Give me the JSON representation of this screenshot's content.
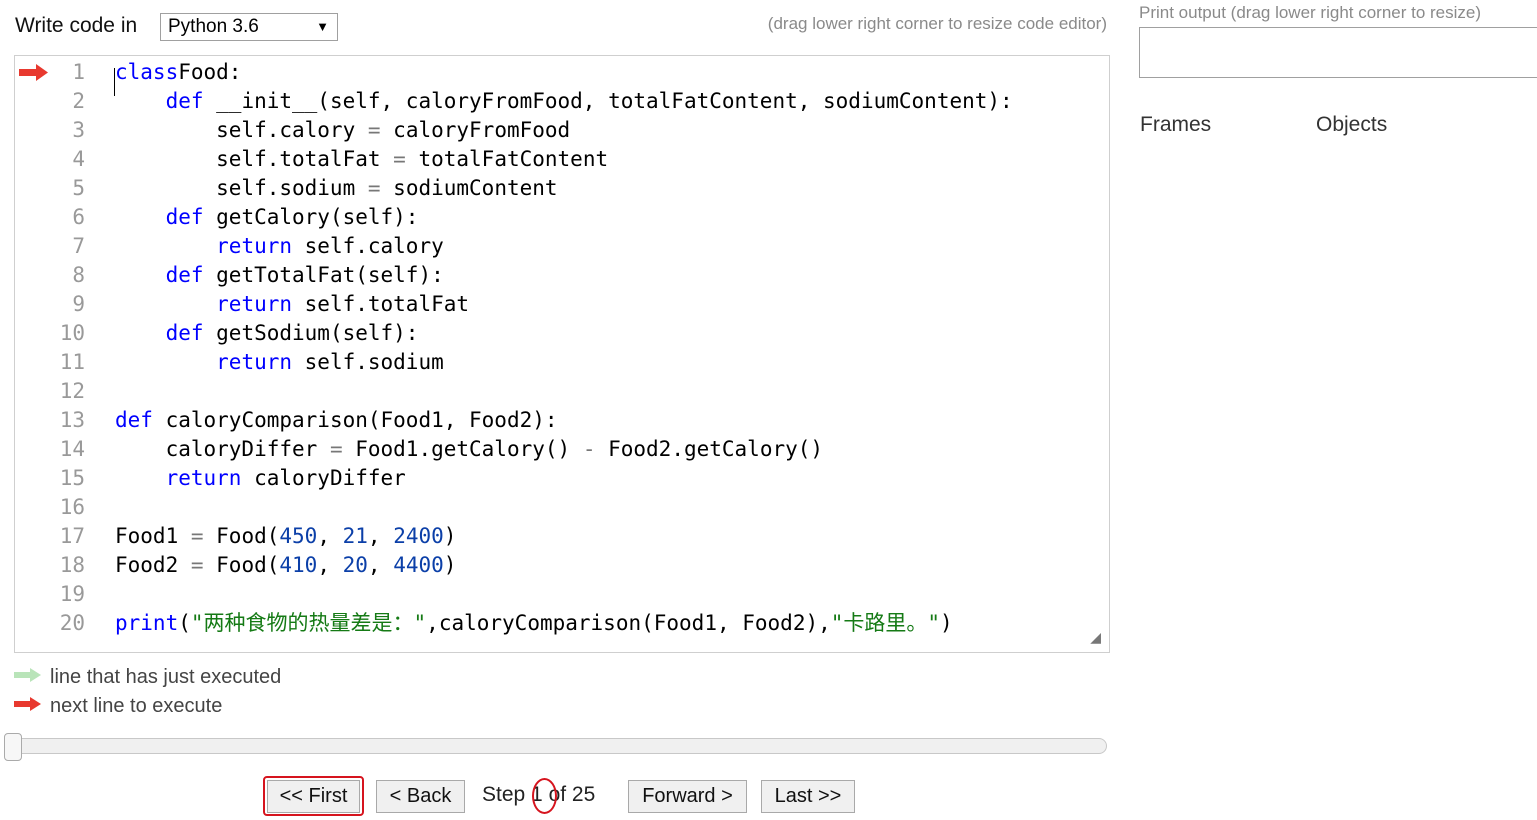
{
  "header": {
    "write_label": "Write code in",
    "language": "Python 3.6",
    "drag_hint": "(drag lower right corner to resize code editor)"
  },
  "editor": {
    "current_line": 1,
    "lines": [
      {
        "n": "1",
        "tokens": [
          [
            "kw",
            "class"
          ],
          [
            "",
            "Food:"
          ]
        ]
      },
      {
        "n": "2",
        "tokens": [
          [
            "",
            "    "
          ],
          [
            "kw",
            "def"
          ],
          [
            "",
            " __init__(self, caloryFromFood, totalFatContent, sodiumContent):"
          ]
        ]
      },
      {
        "n": "3",
        "tokens": [
          [
            "",
            "        self.calory "
          ],
          [
            "op",
            "="
          ],
          [
            "",
            " caloryFromFood"
          ]
        ]
      },
      {
        "n": "4",
        "tokens": [
          [
            "",
            "        self.totalFat "
          ],
          [
            "op",
            "="
          ],
          [
            "",
            " totalFatContent"
          ]
        ]
      },
      {
        "n": "5",
        "tokens": [
          [
            "",
            "        self.sodium "
          ],
          [
            "op",
            "="
          ],
          [
            "",
            " sodiumContent"
          ]
        ]
      },
      {
        "n": "6",
        "tokens": [
          [
            "",
            "    "
          ],
          [
            "kw",
            "def"
          ],
          [
            "",
            " getCalory(self):"
          ]
        ]
      },
      {
        "n": "7",
        "tokens": [
          [
            "",
            "        "
          ],
          [
            "kw",
            "return"
          ],
          [
            "",
            " self.calory"
          ]
        ]
      },
      {
        "n": "8",
        "tokens": [
          [
            "",
            "    "
          ],
          [
            "kw",
            "def"
          ],
          [
            "",
            " getTotalFat(self):"
          ]
        ]
      },
      {
        "n": "9",
        "tokens": [
          [
            "",
            "        "
          ],
          [
            "kw",
            "return"
          ],
          [
            "",
            " self.totalFat"
          ]
        ]
      },
      {
        "n": "10",
        "tokens": [
          [
            "",
            "    "
          ],
          [
            "kw",
            "def"
          ],
          [
            "",
            " getSodium(self):"
          ]
        ]
      },
      {
        "n": "11",
        "tokens": [
          [
            "",
            "        "
          ],
          [
            "kw",
            "return"
          ],
          [
            "",
            " self.sodium"
          ]
        ]
      },
      {
        "n": "12",
        "tokens": []
      },
      {
        "n": "13",
        "tokens": [
          [
            "kw",
            "def"
          ],
          [
            "",
            " caloryComparison(Food1, Food2):"
          ]
        ]
      },
      {
        "n": "14",
        "tokens": [
          [
            "",
            "    caloryDiffer "
          ],
          [
            "op",
            "="
          ],
          [
            "",
            " Food1.getCalory() "
          ],
          [
            "op",
            "-"
          ],
          [
            "",
            " Food2.getCalory()"
          ]
        ]
      },
      {
        "n": "15",
        "tokens": [
          [
            "",
            "    "
          ],
          [
            "kw",
            "return"
          ],
          [
            "",
            " caloryDiffer"
          ]
        ]
      },
      {
        "n": "16",
        "tokens": []
      },
      {
        "n": "17",
        "tokens": [
          [
            "",
            "Food1 "
          ],
          [
            "op",
            "="
          ],
          [
            "",
            " Food("
          ],
          [
            "num",
            "450"
          ],
          [
            "",
            ", "
          ],
          [
            "num",
            "21"
          ],
          [
            "",
            ", "
          ],
          [
            "num",
            "2400"
          ],
          [
            "",
            ")"
          ]
        ]
      },
      {
        "n": "18",
        "tokens": [
          [
            "",
            "Food2 "
          ],
          [
            "op",
            "="
          ],
          [
            "",
            " Food("
          ],
          [
            "num",
            "410"
          ],
          [
            "",
            ", "
          ],
          [
            "num",
            "20"
          ],
          [
            "",
            ", "
          ],
          [
            "num",
            "4400"
          ],
          [
            "",
            ")"
          ]
        ]
      },
      {
        "n": "19",
        "tokens": []
      },
      {
        "n": "20",
        "tokens": [
          [
            "kw",
            "print"
          ],
          [
            "",
            "("
          ],
          [
            "str",
            "\"两种食物的热量差是：\""
          ],
          [
            "",
            ",caloryComparison(Food1, Food2),"
          ],
          [
            "str",
            "\"卡路里。\""
          ],
          [
            "",
            ")"
          ]
        ]
      }
    ]
  },
  "legend": {
    "executed": "line that has just executed",
    "next": "next line to execute"
  },
  "navigation": {
    "first": "<< First",
    "back": "< Back",
    "step_word": "Step",
    "step_current": "1",
    "step_of": "of 25",
    "forward": "Forward >",
    "last": "Last >>"
  },
  "right_panel": {
    "print_label": "Print output (drag lower right corner to resize)",
    "frames": "Frames",
    "objects": "Objects"
  },
  "colors": {
    "keyword": "#0000ff",
    "number": "#0b3fa8",
    "string": "#157a15",
    "next_arrow": "#e8392f",
    "executed_arrow": "#b9e4b9",
    "highlight": "#d6141e"
  }
}
